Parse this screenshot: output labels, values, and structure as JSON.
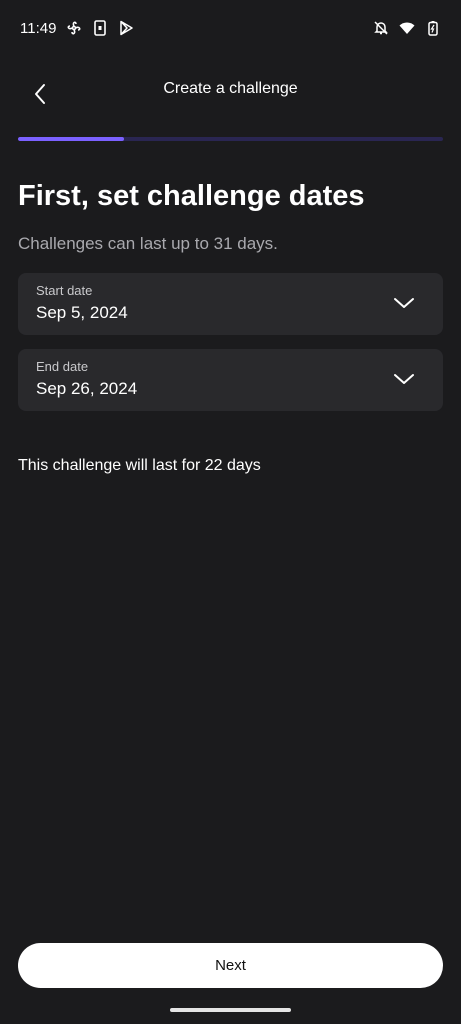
{
  "status_bar": {
    "time": "11:49",
    "left_icons": [
      "fan-icon",
      "sim-icon",
      "play-store-icon"
    ],
    "right_icons": [
      "notifications-off-icon",
      "wifi-icon",
      "battery-icon"
    ]
  },
  "header": {
    "title": "Create a challenge",
    "back_icon": "chevron-left-icon"
  },
  "progress": {
    "fraction": 0.25,
    "color": "#7b61ff",
    "track_color": "#2a2652"
  },
  "main": {
    "title": "First, set challenge dates",
    "subtitle": "Challenges can last up to 31 days.",
    "start_date": {
      "label": "Start date",
      "value": "Sep 5, 2024"
    },
    "end_date": {
      "label": "End date",
      "value": "Sep 26, 2024"
    },
    "duration_text": "This challenge will last for 22 days"
  },
  "footer": {
    "next_label": "Next"
  }
}
